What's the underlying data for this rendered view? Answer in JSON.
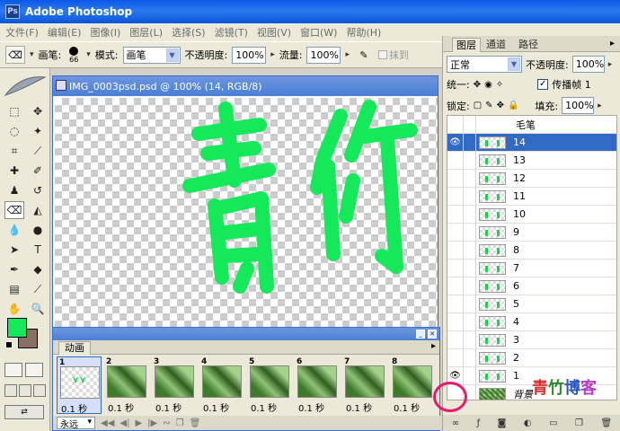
{
  "window": {
    "title": "Adobe Photoshop"
  },
  "menu": [
    "文件(F)",
    "编辑(E)",
    "图像(I)",
    "图层(L)",
    "选择(S)",
    "滤镜(T)",
    "视图(V)",
    "窗口(W)",
    "帮助(H)"
  ],
  "options": {
    "brush_label": "画笔:",
    "brush_size": "66",
    "mode_label": "模式:",
    "mode_value": "画笔",
    "opacity_label": "不透明度:",
    "opacity_value": "100%",
    "flow_label": "流量:",
    "flow_value": "100%",
    "erase_to_history": "抹到"
  },
  "document": {
    "title": "IMG_0003psd.psd @ 100% (14, RGB/8)"
  },
  "colors": {
    "foreground": "#14e95a",
    "background": "#8a6d64",
    "accent": "#316ac5"
  },
  "animation": {
    "tab": "动画",
    "loop": "永远",
    "frames": [
      {
        "num": "1",
        "time": "0.1 秒"
      },
      {
        "num": "2",
        "time": "0.1 秒"
      },
      {
        "num": "3",
        "time": "0.1 秒"
      },
      {
        "num": "4",
        "time": "0.1 秒"
      },
      {
        "num": "5",
        "time": "0.1 秒"
      },
      {
        "num": "6",
        "time": "0.1 秒"
      },
      {
        "num": "7",
        "time": "0.1 秒"
      },
      {
        "num": "8",
        "time": "0.1 秒"
      }
    ]
  },
  "layers_panel": {
    "tabs": [
      "图层",
      "通道",
      "路径"
    ],
    "blend_mode": "正常",
    "opacity_label": "不透明度:",
    "opacity_value": "100%",
    "unify_label": "统一:",
    "propagate_label": "传播帧 1",
    "lock_label": "锁定:",
    "fill_label": "填充:",
    "fill_value": "100%",
    "layers": [
      "毛笔",
      "14",
      "13",
      "12",
      "11",
      "10",
      "9",
      "8",
      "7",
      "6",
      "5",
      "4",
      "3",
      "2",
      "1",
      "背景"
    ]
  },
  "watermark": [
    "青",
    "竹",
    "博",
    "客"
  ]
}
